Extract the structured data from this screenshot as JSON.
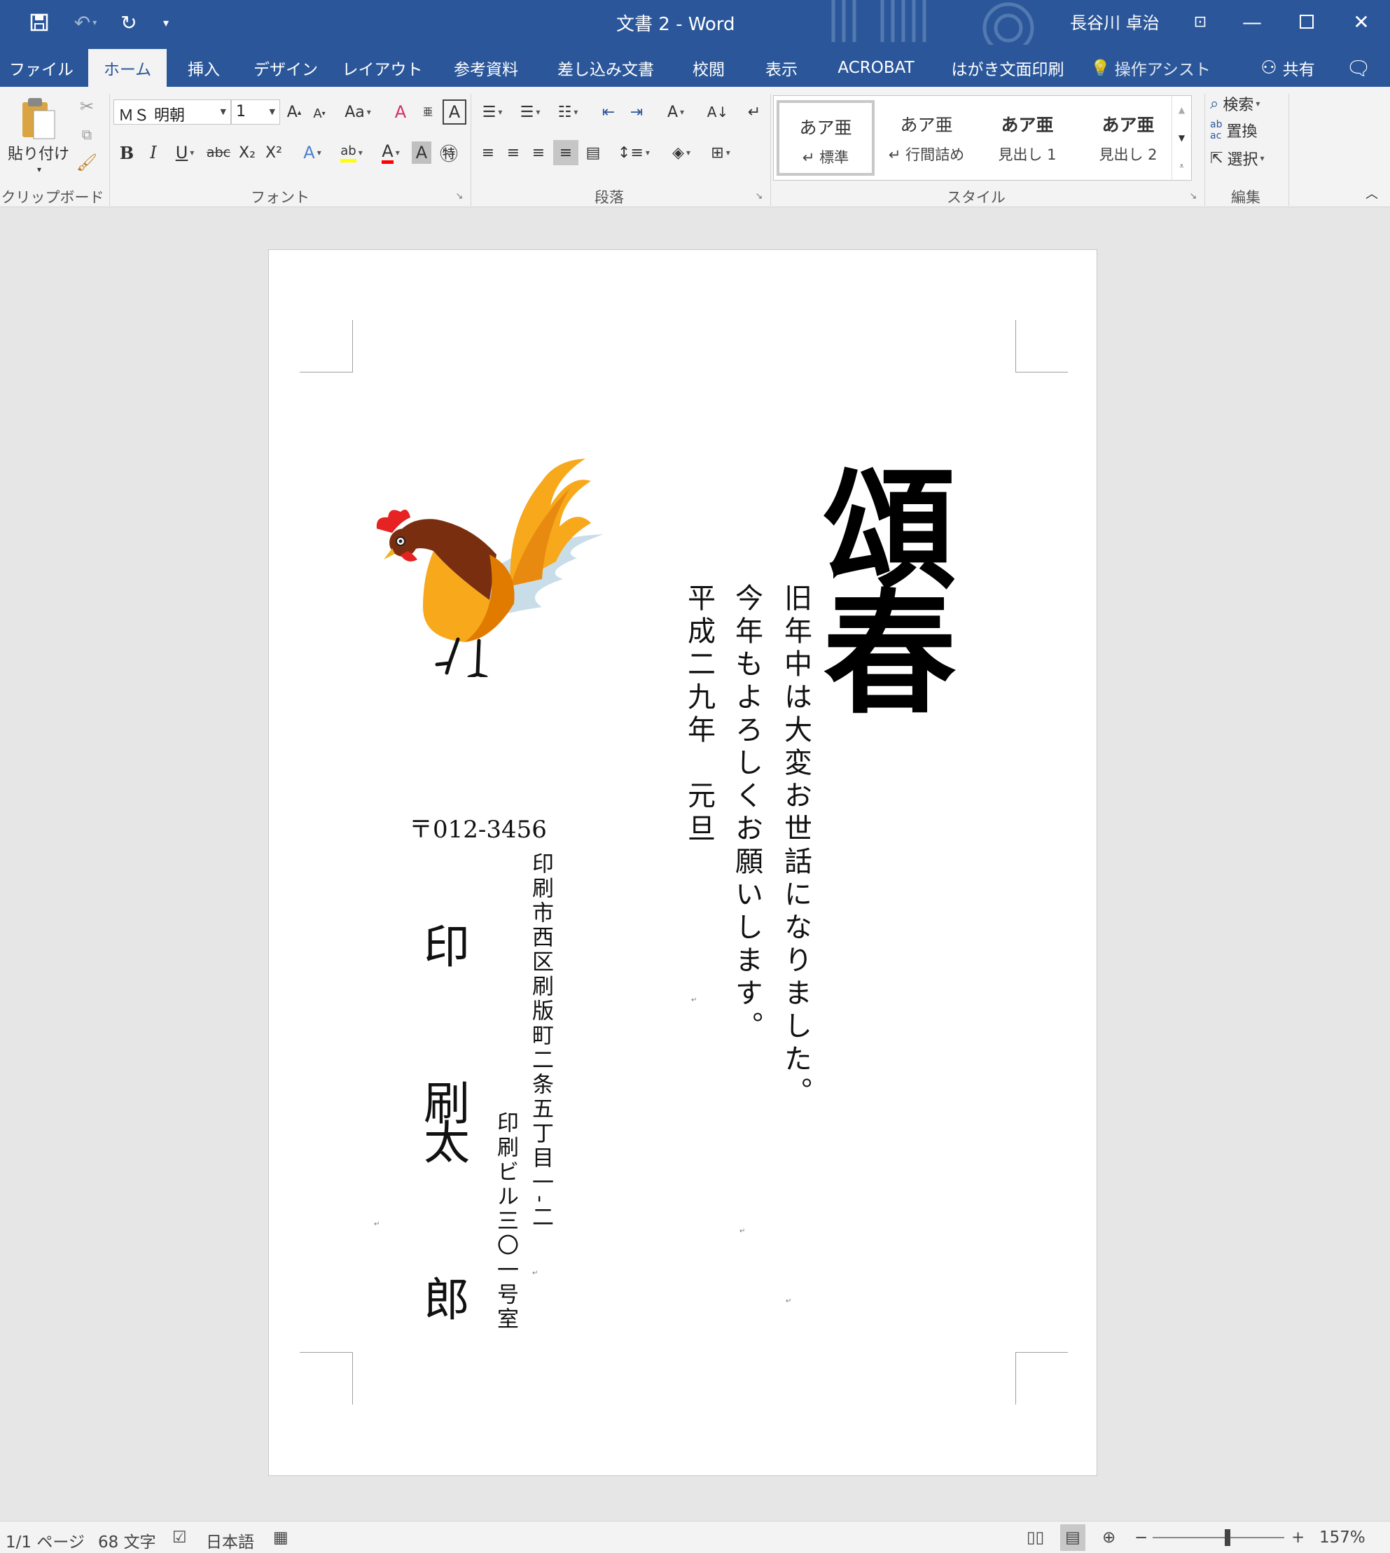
{
  "titlebar": {
    "title": "文書 2  -  Word",
    "user": "長谷川 卓治",
    "accent": "#2b579a"
  },
  "tabs": [
    "ファイル",
    "ホーム",
    "挿入",
    "デザイン",
    "レイアウト",
    "参考資料",
    "差し込み文書",
    "校閲",
    "表示",
    "ACROBAT",
    "はがき文面印刷"
  ],
  "tell_me": "操作アシスト",
  "share_label": "共有",
  "clipboard": {
    "paste_label": "貼り付け",
    "group_label": "クリップボード"
  },
  "font": {
    "name": "ＭＳ 明朝",
    "size": "1",
    "group_label": "フォント",
    "case_label": "Aa",
    "bold": "B",
    "italic": "I",
    "underline": "U",
    "strike": "abc",
    "subscript": "X₂",
    "superscript": "X²",
    "font_color": "A",
    "char_shading": "A",
    "enclose": "㊕",
    "ruby": "亜",
    "border_char": "A",
    "highlight_color": "#ffff00",
    "font_color_value": "#ff0000"
  },
  "paragraph": {
    "group_label": "段落"
  },
  "styles": {
    "group_label": "スタイル",
    "items": [
      {
        "sample": "あア亜",
        "name": "標準"
      },
      {
        "sample": "あア亜",
        "name": "行間詰め"
      },
      {
        "sample": "あア亜",
        "name": "見出し 1"
      },
      {
        "sample": "あア亜",
        "name": "見出し 2"
      }
    ]
  },
  "editing": {
    "group_label": "編集",
    "find": "検索",
    "replace": "置換",
    "select": "選択"
  },
  "document": {
    "title_calligraphy": "頌春",
    "greeting_line1": "旧年中は大変お世話になりました。",
    "greeting_line2": "今年もよろしくお願いします。",
    "date": "平成二九年　元旦",
    "postal_code": "〒012-3456",
    "address_line1": "印刷市西区刷版町二条五丁目一‐二",
    "address_line2": "印刷ビル三〇一号室",
    "name_family": "印　刷",
    "name_given": "太　郎",
    "illustration": "rooster"
  },
  "statusbar": {
    "page": "1/1 ページ",
    "words": "68 文字",
    "language": "日本語",
    "zoom": "157%",
    "zoom_level_percent": 157
  }
}
